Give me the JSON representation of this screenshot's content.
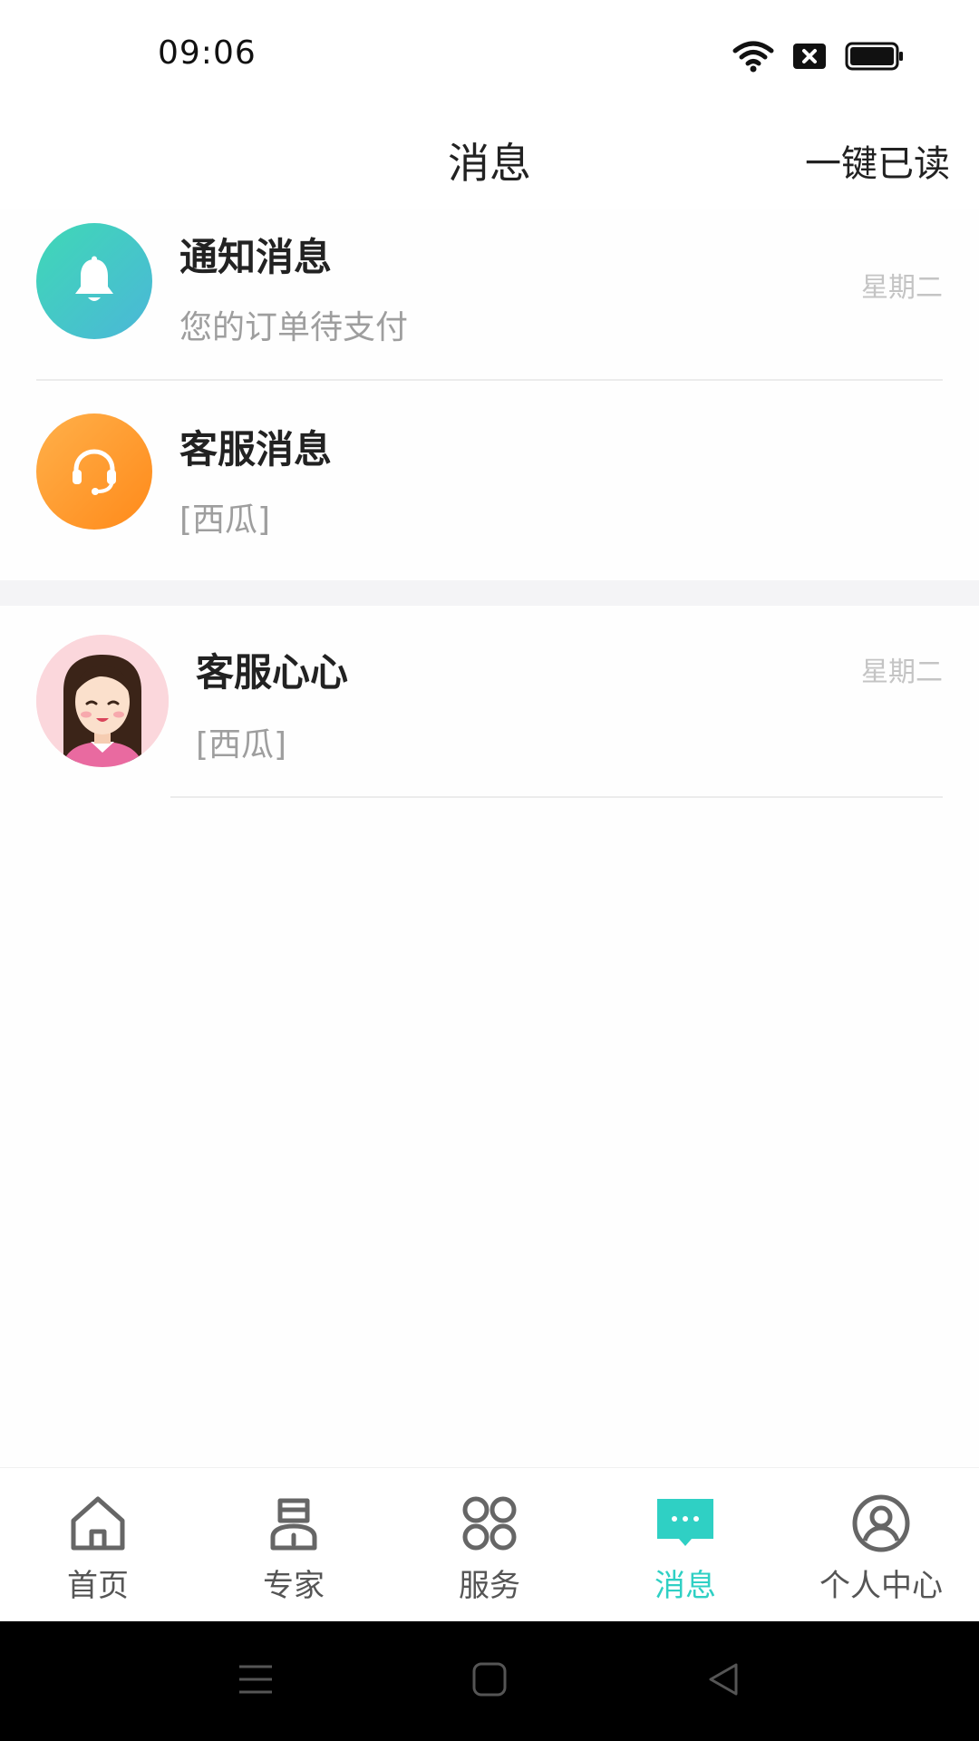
{
  "status_bar": {
    "time": "09:06"
  },
  "header": {
    "title": "消息",
    "mark_all_read": "一键已读"
  },
  "system_messages": [
    {
      "title": "通知消息",
      "subtitle": "您的订单待支付",
      "date": "星期二",
      "icon": "bell-icon",
      "color": "#3fd2bc"
    },
    {
      "title": "客服消息",
      "subtitle": "[西瓜]",
      "icon": "headset-icon",
      "color": "#ff9a2e"
    }
  ],
  "chats": [
    {
      "name": "客服心心",
      "subtitle": "[西瓜]",
      "date": "星期二"
    }
  ],
  "tab_bar": {
    "accent": "#2fd0c4",
    "tabs": [
      {
        "label": "首页",
        "icon": "home-icon"
      },
      {
        "label": "专家",
        "icon": "expert-icon"
      },
      {
        "label": "服务",
        "icon": "grid-icon"
      },
      {
        "label": "消息",
        "icon": "message-icon",
        "active": true
      },
      {
        "label": "个人中心",
        "icon": "user-icon"
      }
    ]
  }
}
